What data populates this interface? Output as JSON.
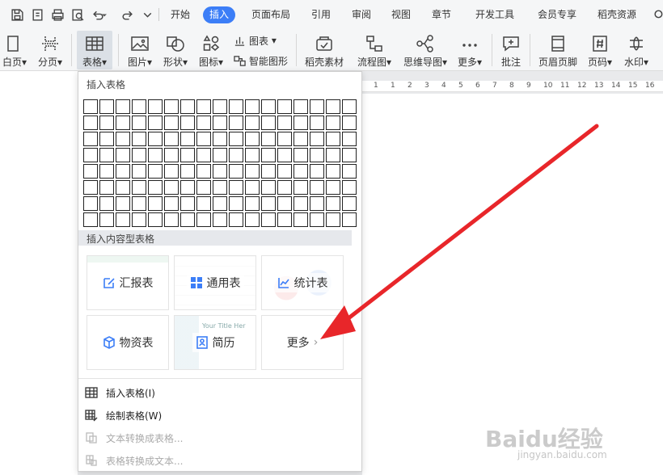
{
  "menus": [
    "开始",
    "插入",
    "页面布局",
    "引用",
    "审阅",
    "视图",
    "章节",
    "开发工具",
    "会员专享",
    "稻壳资源"
  ],
  "active_menu": "插入",
  "ribbon": {
    "blank_page": "白页",
    "page_break": "分页",
    "table": "表格",
    "picture": "图片",
    "shape": "形状",
    "icon": "图标",
    "chart": "图表",
    "smart_graphic": "智能图形",
    "docer_material": "稻壳素材",
    "flowchart": "流程图",
    "mind_map": "思维导图",
    "more": "更多",
    "comment": "批注",
    "header_footer": "页眉页脚",
    "page_number": "页码",
    "watermark": "水印"
  },
  "ruler_ticks": [
    "1",
    "1",
    "2",
    "3",
    "4",
    "5",
    "6",
    "7",
    "8",
    "9",
    "10",
    "11",
    "12",
    "13",
    "14",
    "15",
    "16",
    "17"
  ],
  "dropdown": {
    "insert_table_title": "插入表格",
    "grid_rows": 8,
    "grid_cols": 17,
    "content_tables_title": "插入内容型表格",
    "cards": {
      "report": "汇报表",
      "general": "通用表",
      "statistics": "统计表",
      "materials": "物资表",
      "resume": "简历",
      "more": "更多"
    },
    "items": {
      "insert_table": "插入表格(I)",
      "draw_table": "绘制表格(W)",
      "text_to_table": "文本转换成表格...",
      "table_to_text": "表格转换成文本..."
    }
  },
  "resume_thumb_text": "Your Title Her",
  "watermark": {
    "logo": "Baidu经验",
    "url": "jingyan.baidu.com"
  },
  "colors": {
    "accent": "#3c7ef7",
    "arrow": "#e8262a"
  }
}
